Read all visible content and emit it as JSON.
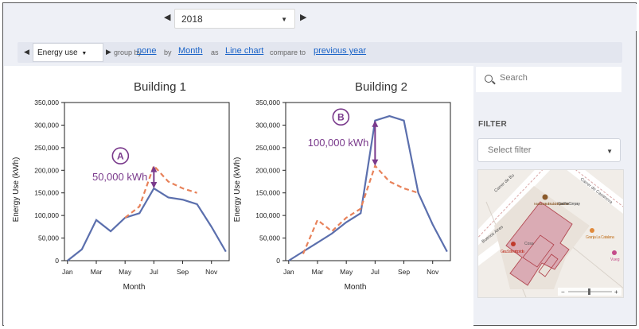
{
  "period": {
    "year": "2018",
    "prev_arrow": "◀",
    "next_arrow": "▶"
  },
  "toolbar": {
    "prev_arrow": "◀",
    "next_arrow": "▶",
    "metric": "Energy use",
    "group_by_label": "group by",
    "group_by_value": "none",
    "by_label": "by",
    "by_value": "Month",
    "as_label": "as",
    "chart_type_value": "Line chart",
    "compare_label": "compare to",
    "compare_value": "previous year"
  },
  "search": {
    "placeholder": "Search"
  },
  "filter": {
    "label": "FILTER",
    "placeholder": "Select filter"
  },
  "map": {
    "labels": {
      "street1": "Carrer de Bu",
      "street2": "Carrer de Casanova",
      "street3": "Buenos Aires",
      "museum": "Museu i Centre d'Estudis de l'Esport Doctor",
      "building": "Casa Pere Company",
      "shop": "Granja La Catalana",
      "shop2": "Vueg",
      "pharmacy": "Grau Soler ortopèdia",
      "pharmacy2": "Cosa"
    },
    "zoom_minus": "−",
    "zoom_plus": "+"
  },
  "colors": {
    "current": "#5b6fad",
    "previous": "#e8825a",
    "annotation": "#7a3a8c",
    "link": "#1a63c7"
  },
  "chart_data": [
    {
      "type": "line",
      "title": "Building 1",
      "xlabel": "Month",
      "ylabel": "Energy Use (kWh)",
      "x": [
        "Jan",
        "Feb",
        "Mar",
        "Apr",
        "May",
        "Jun",
        "Jul",
        "Aug",
        "Sep",
        "Oct",
        "Nov",
        "Dec"
      ],
      "x_tick_labels": [
        "Jan",
        "Mar",
        "May",
        "Jul",
        "Sep",
        "Nov"
      ],
      "y_tick_labels": [
        "0",
        "50,000",
        "100,000",
        "150,000",
        "200,000",
        "250,000",
        "300,000",
        "350,000"
      ],
      "ylim": [
        0,
        350000
      ],
      "series": [
        {
          "values": [
            0,
            25000,
            90000,
            65000,
            95000,
            105000,
            160000,
            140000,
            135000,
            125000,
            75000,
            20000
          ]
        },
        {
          "values": [
            null,
            null,
            null,
            null,
            95000,
            120000,
            210000,
            175000,
            160000,
            150000,
            null,
            null
          ]
        }
      ],
      "annotation": {
        "marker": "A",
        "text": "50,000 kWh",
        "month_index": 6,
        "from": 160000,
        "to": 210000
      }
    },
    {
      "type": "line",
      "title": "Building 2",
      "xlabel": "Month",
      "ylabel": "Energy Use (kWh)",
      "x": [
        "Jan",
        "Feb",
        "Mar",
        "Apr",
        "May",
        "Jun",
        "Jul",
        "Aug",
        "Sep",
        "Oct",
        "Nov",
        "Dec"
      ],
      "x_tick_labels": [
        "Jan",
        "Mar",
        "May",
        "Jul",
        "Sep",
        "Nov"
      ],
      "y_tick_labels": [
        "0",
        "50,000",
        "100,000",
        "150,000",
        "200,000",
        "250,000",
        "300,000",
        "350,000"
      ],
      "ylim": [
        0,
        350000
      ],
      "series": [
        {
          "values": [
            0,
            20000,
            40000,
            60000,
            85000,
            105000,
            310000,
            320000,
            310000,
            150000,
            80000,
            20000
          ]
        },
        {
          "values": [
            null,
            15000,
            90000,
            65000,
            95000,
            115000,
            210000,
            175000,
            160000,
            150000,
            null,
            null
          ]
        }
      ],
      "annotation": {
        "marker": "B",
        "text": "100,000 kWh",
        "month_index": 6,
        "from": 210000,
        "to": 310000
      }
    }
  ]
}
